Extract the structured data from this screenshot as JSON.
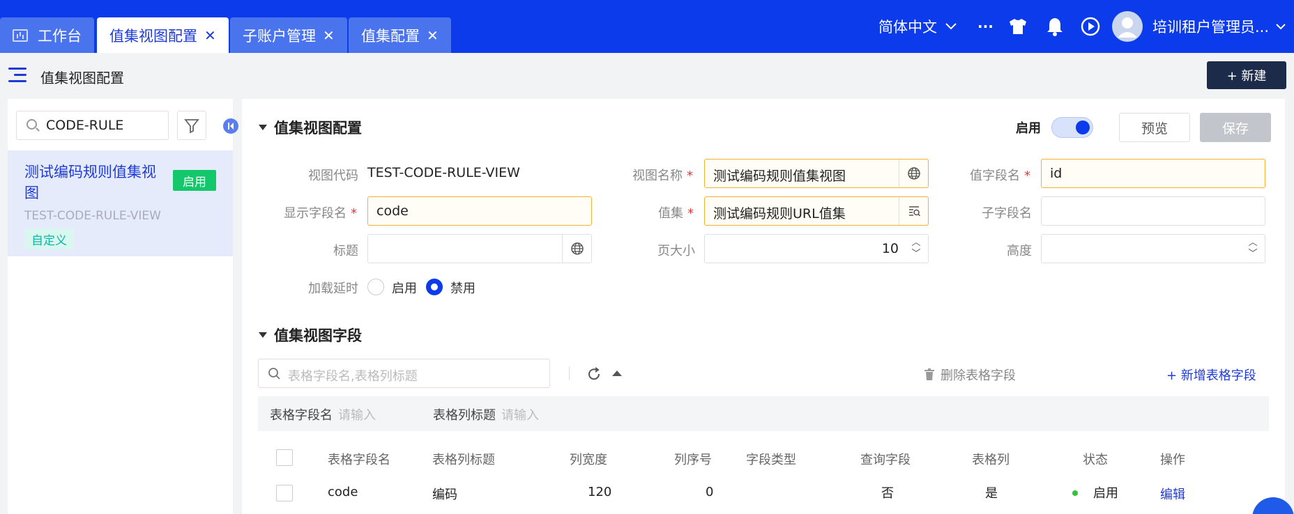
{
  "tabs": [
    {
      "label": "工作台",
      "active": false,
      "closable": false
    },
    {
      "label": "值集视图配置",
      "active": true,
      "closable": true
    },
    {
      "label": "子账户管理",
      "active": false,
      "closable": true
    },
    {
      "label": "值集配置",
      "active": false,
      "closable": true
    }
  ],
  "topbar": {
    "language": "简体中文",
    "more": "···",
    "user_name": "培训租户管理员...",
    "colors": {
      "primary": "#0b3bea",
      "tab": "#4a73ee"
    }
  },
  "subheader": {
    "title": "值集视图配置",
    "new_button": "+ 新建"
  },
  "left": {
    "search_value": "CODE-RULE",
    "item": {
      "title": "测试编码规则值集视图",
      "status": "启用",
      "code": "TEST-CODE-RULE-VIEW",
      "tag": "自定义"
    }
  },
  "main": {
    "section1_title": "值集视图配置",
    "enabled_label": "启用",
    "enabled": true,
    "preview_button": "预览",
    "save_button": "保存",
    "form": {
      "view_code_label": "视图代码",
      "view_code_value": "TEST-CODE-RULE-VIEW",
      "view_name_label": "视图名称",
      "view_name_value": "测试编码规则值集视图",
      "value_field_label": "值字段名",
      "value_field_value": "id",
      "display_field_label": "显示字段名",
      "display_field_value": "code",
      "value_set_label": "值集",
      "value_set_value": "测试编码规则URL值集",
      "child_field_label": "子字段名",
      "child_field_value": "",
      "title_label": "标题",
      "title_value": "",
      "page_size_label": "页大小",
      "page_size_value": "10",
      "height_label": "高度",
      "height_value": "",
      "lazy_load_label": "加载延时",
      "lazy_options": [
        "启用",
        "禁用"
      ],
      "lazy_selected": "禁用",
      "required_mark": "*"
    },
    "section2_title": "值集视图字段",
    "table_search_placeholder": "表格字段名,表格列标题",
    "delete_button": "删除表格字段",
    "add_button": "+ 新增表格字段",
    "filters": {
      "field_name_label": "表格字段名",
      "field_name_placeholder": "请输入",
      "column_title_label": "表格列标题",
      "column_title_placeholder": "请输入"
    },
    "table": {
      "columns": [
        "表格字段名",
        "表格列标题",
        "列宽度",
        "列序号",
        "字段类型",
        "查询字段",
        "表格列",
        "状态",
        "操作"
      ],
      "rows": [
        {
          "field_name": "code",
          "column_title": "编码",
          "width": "120",
          "order": "0",
          "type": "",
          "query": "否",
          "table_col": "是",
          "status": "启用",
          "action": "编辑"
        }
      ]
    }
  }
}
